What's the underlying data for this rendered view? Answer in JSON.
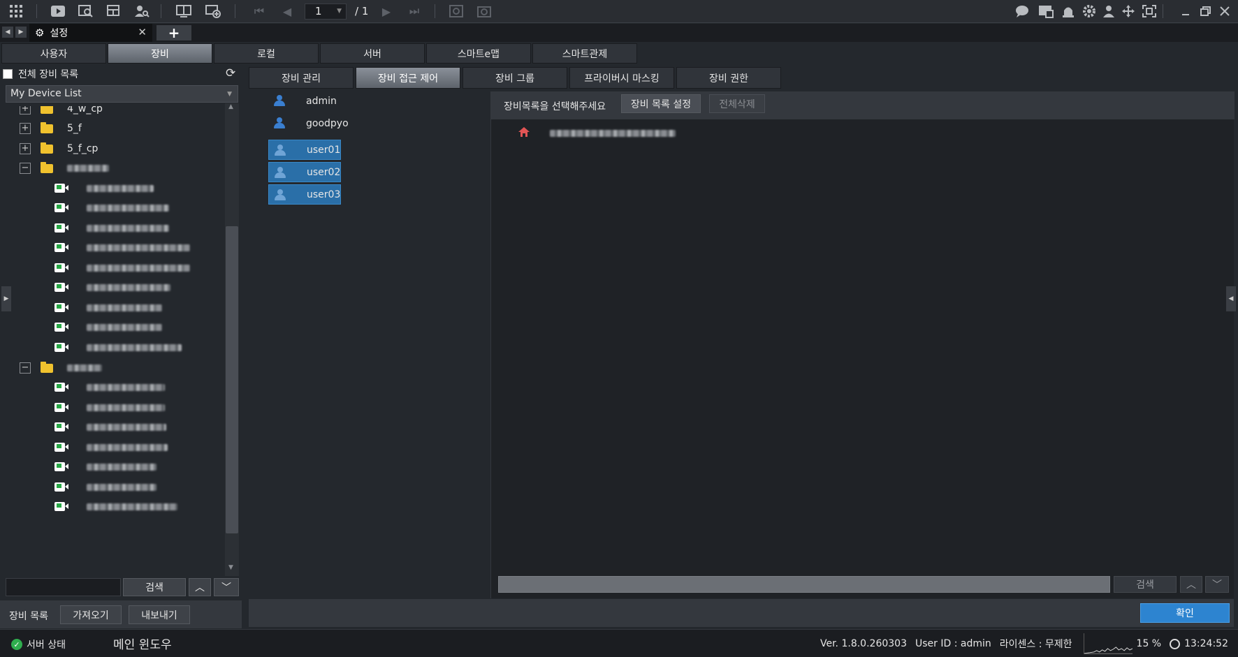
{
  "toolbar": {
    "page_current": "1",
    "page_total": "/ 1",
    "icons": [
      "grid-icon",
      "live-view-icon",
      "playback-search-icon",
      "layout-icon",
      "search-person-icon",
      "monitor-icon",
      "add-screen-icon",
      "first-page-icon",
      "prev-page-icon",
      "next-page-icon",
      "last-page-icon",
      "rotate-icon",
      "capture-icon",
      "chat-icon",
      "event-icon",
      "alarm-icon",
      "settings-icon",
      "user-icon",
      "move-icon",
      "fullscreen-icon",
      "minimize-icon",
      "restore-icon",
      "close-icon"
    ]
  },
  "tabstrip": {
    "settings_label": "설정",
    "add_label": "+"
  },
  "main_tabs": [
    "사용자",
    "장비",
    "로컬",
    "서버",
    "스마트e맵",
    "스마트관제"
  ],
  "main_tab_active": "장비",
  "left_panel": {
    "all_devices_label": "전체 장비 목록",
    "device_list_select": "My Device List",
    "tree": [
      {
        "type": "folder",
        "label": "4_w_cp",
        "expander": "+"
      },
      {
        "type": "folder",
        "label": "5_f",
        "expander": "+"
      },
      {
        "type": "folder",
        "label": "5_f_cp",
        "expander": "+"
      },
      {
        "type": "folder",
        "label": "",
        "expander": "−"
      },
      {
        "type": "camera",
        "label": ""
      },
      {
        "type": "camera",
        "label": ""
      },
      {
        "type": "camera",
        "label": ""
      },
      {
        "type": "camera",
        "label": ""
      },
      {
        "type": "camera",
        "label": ""
      },
      {
        "type": "camera",
        "label": ""
      },
      {
        "type": "camera",
        "label": ""
      },
      {
        "type": "camera",
        "label": ""
      },
      {
        "type": "camera",
        "label": ""
      },
      {
        "type": "folder",
        "label": "",
        "expander": "−"
      },
      {
        "type": "camera",
        "label": ""
      },
      {
        "type": "camera",
        "label": ""
      },
      {
        "type": "camera",
        "label": ""
      },
      {
        "type": "camera",
        "label": ""
      },
      {
        "type": "camera",
        "label": ""
      },
      {
        "type": "camera",
        "label": ""
      },
      {
        "type": "camera",
        "label": ""
      }
    ],
    "search_button": "검색",
    "device_list_label": "장비 목록",
    "import_button": "가져오기",
    "export_button": "내보내기"
  },
  "sub_tabs": [
    "장비 관리",
    "장비 접근 제어",
    "장비 그룹",
    "프라이버시 마스킹",
    "장비 권한"
  ],
  "sub_tab_active": "장비 접근 제어",
  "users": [
    {
      "name": "admin",
      "selected": false
    },
    {
      "name": "goodpyo",
      "selected": false
    },
    {
      "name": "user01",
      "selected": true
    },
    {
      "name": "user02",
      "selected": true
    },
    {
      "name": "user03",
      "selected": true
    }
  ],
  "device_panel": {
    "prompt": "장비목록을 선택해주세요",
    "set_list_button": "장비 목록 설정",
    "delete_all_button": "전체삭제",
    "search_button": "검색"
  },
  "ok_button": "확인",
  "statusbar": {
    "server_status": "서버 상태",
    "main_window": "메인 윈도우",
    "version": "Ver. 1.8.0.260303",
    "user_id": "User ID : admin",
    "license": "라이센스 : 무제한",
    "cpu": "15 %",
    "time": "13:24:52"
  },
  "colors": {
    "accent": "#2d84d0",
    "selection": "#2a6fa8",
    "folder": "#f0c22e",
    "camera_ok": "#27a845",
    "house": "#e25555"
  }
}
